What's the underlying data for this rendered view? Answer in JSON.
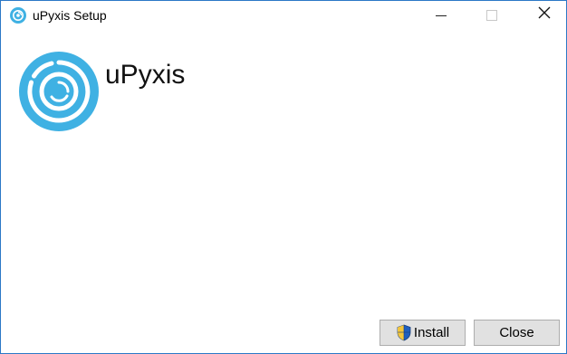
{
  "window": {
    "title": "uPyxis Setup",
    "title_icon": "upyxis-logo-icon"
  },
  "titlebar_buttons": {
    "minimize_icon": "minimize-icon",
    "maximize_icon": "maximize-icon",
    "close_icon": "close-icon",
    "close_glyph": "✕"
  },
  "main": {
    "app_name": "uPyxis",
    "logo_icon": "upyxis-logo-icon"
  },
  "buttons": {
    "install_label": "Install",
    "install_icon": "uac-shield-icon",
    "close_label": "Close"
  },
  "colors": {
    "logo_blue": "#3fb1e3",
    "window_border": "#2b78c7",
    "button_face": "#e1e1e1"
  }
}
